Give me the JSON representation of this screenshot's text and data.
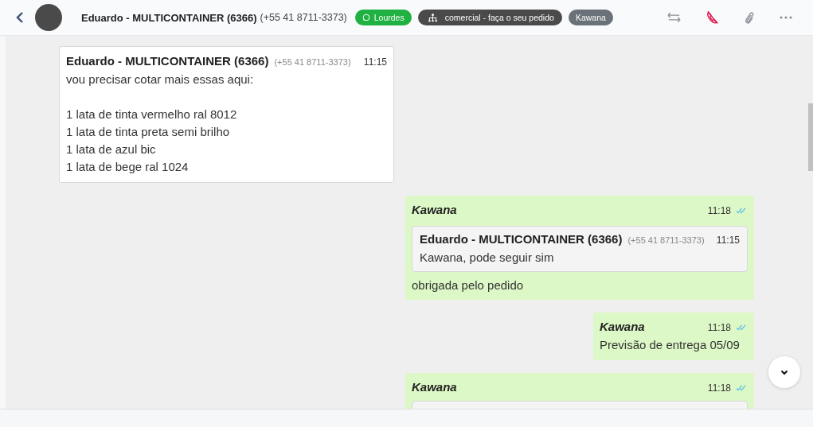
{
  "header": {
    "contact_name": "Eduardo - MULTICONTAINER (6366)",
    "contact_phone": "(+55 41 8711-3373)",
    "tags": [
      {
        "kind": "whatsapp",
        "label": "Lourdes"
      },
      {
        "kind": "department",
        "label": "comercial - faça o seu pedido"
      },
      {
        "kind": "agent",
        "label": "Kawana"
      }
    ]
  },
  "messages": [
    {
      "kind": "incoming",
      "author": "Eduardo - MULTICONTAINER (6366)",
      "phone": "(+55 41 8711-3373)",
      "time": "11:15",
      "paragraphs": [
        [
          "vou precisar cotar mais essas aqui:"
        ],
        [
          "1 lata de tinta vermelho ral 8012",
          "1 lata de tinta preta semi brilho",
          "1 lata de azul bic",
          "1 lata de bege ral 1024"
        ]
      ]
    },
    {
      "kind": "outgoing",
      "author": "Kawana",
      "time": "11:18",
      "read": true,
      "quote": {
        "author": "Eduardo - MULTICONTAINER (6366)",
        "phone": "(+55 41 8711-3373)",
        "time": "11:15",
        "text": "Kawana, pode seguir sim"
      },
      "paragraphs": [
        [
          "obrigada pelo pedido"
        ]
      ]
    },
    {
      "kind": "outgoing",
      "author": "Kawana",
      "time": "11:18",
      "read": true,
      "paragraphs": [
        [
          "Previsão de entrega 05/09"
        ]
      ]
    },
    {
      "kind": "outgoing",
      "author": "Kawana",
      "time": "11:18",
      "read": true,
      "quote_cut_off": true
    }
  ]
}
